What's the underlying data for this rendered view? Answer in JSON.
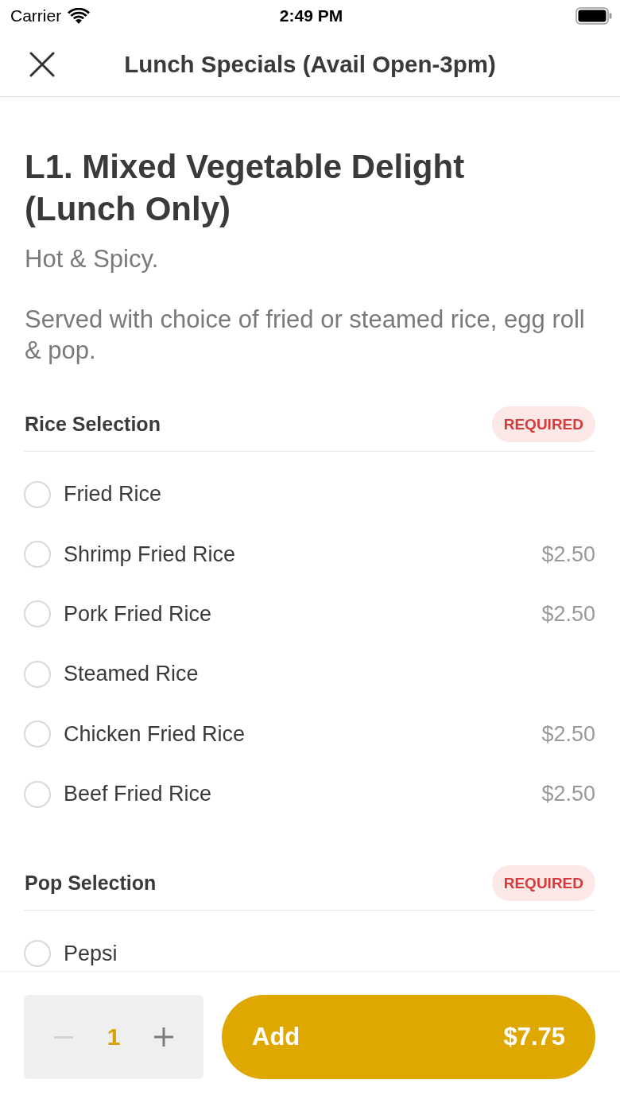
{
  "status_bar": {
    "carrier": "Carrier",
    "time": "2:49 PM"
  },
  "nav_bar": {
    "title": "Lunch Specials (Avail Open-3pm)"
  },
  "item": {
    "title": "L1. Mixed Vegetable Delight (Lunch Only)",
    "tagline": "Hot & Spicy.",
    "description": "Served with choice of fried or steamed rice, egg roll & pop."
  },
  "sections": [
    {
      "title": "Rice Selection",
      "badge": "REQUIRED",
      "options": [
        {
          "name": "Fried Rice",
          "selected": false
        },
        {
          "name": "Shrimp Fried Rice",
          "price": "$2.50",
          "selected": false
        },
        {
          "name": "Pork Fried Rice",
          "price": "$2.50",
          "selected": false
        },
        {
          "name": "Steamed Rice",
          "selected": false
        },
        {
          "name": "Chicken Fried Rice",
          "price": "$2.50",
          "selected": false
        },
        {
          "name": "Beef Fried Rice",
          "price": "$2.50",
          "selected": false
        }
      ]
    },
    {
      "title": "Pop Selection",
      "badge": "REQUIRED",
      "options": [
        {
          "name": "Pepsi",
          "selected": false
        }
      ]
    }
  ],
  "footer": {
    "quantity": "1",
    "decrease_disabled": true,
    "add_label": "Add",
    "total": "$7.75"
  }
}
